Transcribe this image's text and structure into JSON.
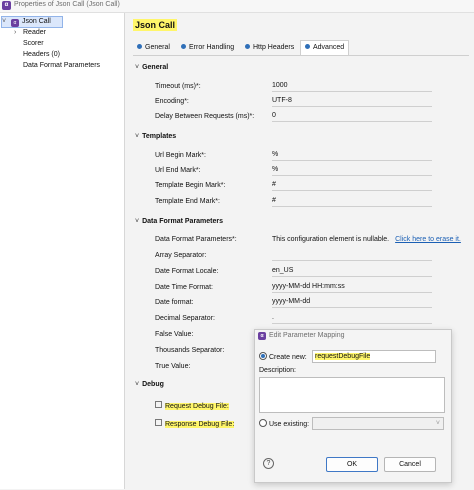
{
  "window": {
    "title": "Properties of Json Call (Json Call)"
  },
  "tree": {
    "root": "Json Call",
    "children": [
      "Reader",
      "Scorer",
      "Headers (0)",
      "Data Format Parameters"
    ]
  },
  "main": {
    "heading": "Json Call",
    "tabs": [
      "General",
      "Error Handling",
      "Http Headers",
      "Advanced"
    ],
    "sections": {
      "general": {
        "title": "General",
        "rows": [
          {
            "label": "Timeout (ms)*:",
            "value": "1000"
          },
          {
            "label": "Encoding*:",
            "value": "UTF-8"
          },
          {
            "label": "Delay Between Requests (ms)*:",
            "value": "0"
          }
        ]
      },
      "templates": {
        "title": "Templates",
        "rows": [
          {
            "label": "Url Begin Mark*:",
            "value": "%"
          },
          {
            "label": "Url End Mark*:",
            "value": "%"
          },
          {
            "label": "Template Begin Mark*:",
            "value": "#"
          },
          {
            "label": "Template End Mark*:",
            "value": "#"
          }
        ]
      },
      "dfp": {
        "title": "Data Format Parameters",
        "params_label": "Data Format Parameters*:",
        "nullable_note": "This configuration element is nullable.",
        "erase_link": "Click here to erase it.",
        "rows": [
          {
            "label": "Array Separator:",
            "value": ""
          },
          {
            "label": "Date Format Locale:",
            "value": "en_US"
          },
          {
            "label": "Date Time Format:",
            "value": "yyyy-MM-dd HH:mm:ss"
          },
          {
            "label": "Date format:",
            "value": "yyyy-MM-dd"
          },
          {
            "label": "Decimal Separator:",
            "value": "."
          },
          {
            "label": "False Value:",
            "value": ""
          },
          {
            "label": "Thousands Separator:",
            "value": ""
          },
          {
            "label": "True Value:",
            "value": ""
          }
        ]
      },
      "debug": {
        "title": "Debug",
        "request_label": "Request Debug File:",
        "response_label": "Response Debug File:"
      }
    }
  },
  "dialog": {
    "title": "Edit Parameter Mapping",
    "create_new_label": "Create new:",
    "create_new_value": "requestDebugFile",
    "description_label": "Description:",
    "use_existing_label": "Use existing:",
    "ok_label": "OK",
    "cancel_label": "Cancel",
    "help_glyph": "?"
  }
}
